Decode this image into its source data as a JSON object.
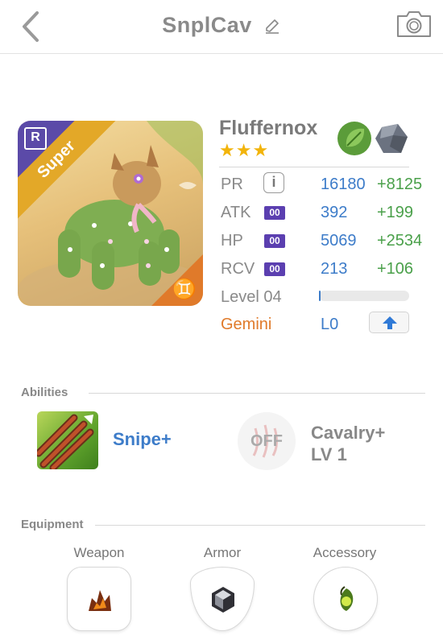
{
  "header": {
    "title": "SnplCav"
  },
  "monster": {
    "name": "Fluffernox",
    "stars": "★★★",
    "rank_badge": "R",
    "ribbon": "Super",
    "zodiac_glyph": "♊",
    "elements": [
      "leaf-icon",
      "rock-icon"
    ],
    "element_colors": {
      "leaf": "#5b9c3a",
      "rock": "#6b7280"
    }
  },
  "stats": {
    "pr": {
      "label": "PR",
      "value": "16180",
      "plus": "+8125"
    },
    "atk": {
      "label": "ATK",
      "box": "00",
      "value": "392",
      "plus": "+199"
    },
    "hp": {
      "label": "HP",
      "box": "00",
      "value": "5069",
      "plus": "+2534"
    },
    "rcv": {
      "label": "RCV",
      "box": "00",
      "value": "213",
      "plus": "+106"
    },
    "level_label": "Level 04",
    "level_progress": 0.02,
    "zodiac_name": "Gemini",
    "limit": "L0"
  },
  "abilities": {
    "title": "Abilities",
    "active": {
      "name": "Snipe+"
    },
    "passive": {
      "state": "OFF",
      "name_line1": "Cavalry+",
      "name_line2": "LV 1"
    }
  },
  "equipment": {
    "title": "Equipment",
    "slots": [
      {
        "label": "Weapon"
      },
      {
        "label": "Armor"
      },
      {
        "label": "Accessory"
      }
    ]
  },
  "colors": {
    "accent_blue": "#3d7cc9",
    "bonus_green": "#4aa04a",
    "zodiac_orange": "#e07a2a",
    "rank_purple": "#5b4aa8"
  }
}
